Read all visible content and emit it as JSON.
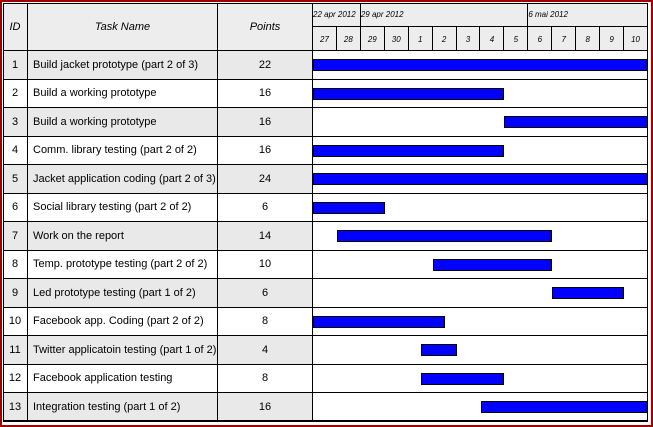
{
  "header": {
    "id": "ID",
    "task": "Task Name",
    "points": "Points"
  },
  "weeks": [
    "22 apr 2012",
    "29 apr 2012",
    "6 mai 2012"
  ],
  "days": [
    "27",
    "28",
    "29",
    "30",
    "1",
    "2",
    "3",
    "4",
    "5",
    "6",
    "7",
    "8",
    "9",
    "10"
  ],
  "tasks": [
    {
      "id": "1",
      "name": "Build jacket prototype (part 2 of 3)",
      "points": "22",
      "start": 0,
      "end": 14
    },
    {
      "id": "2",
      "name": "Build a working prototype",
      "points": "16",
      "start": 0,
      "end": 8
    },
    {
      "id": "3",
      "name": "Build a working prototype",
      "points": "16",
      "start": 8,
      "end": 14
    },
    {
      "id": "4",
      "name": "Comm. library testing (part 2 of 2)",
      "points": "16",
      "start": 0,
      "end": 8
    },
    {
      "id": "5",
      "name": "Jacket application coding (part 2 of 3)",
      "points": "24",
      "start": 0,
      "end": 14
    },
    {
      "id": "6",
      "name": "Social library testing (part 2 of 2)",
      "points": "6",
      "start": 0,
      "end": 3
    },
    {
      "id": "7",
      "name": "Work on the report",
      "points": "14",
      "start": 1,
      "end": 10
    },
    {
      "id": "8",
      "name": "Temp. prototype testing (part 2 of 2)",
      "points": "10",
      "start": 5,
      "end": 10
    },
    {
      "id": "9",
      "name": "Led prototype testing (part 1 of 2)",
      "points": "6",
      "start": 10,
      "end": 13
    },
    {
      "id": "10",
      "name": "Facebook app. Coding (part 2 of 2)",
      "points": "8",
      "start": 0,
      "end": 5.5
    },
    {
      "id": "11",
      "name": "Twitter applicatoin testing (part 1 of 2)",
      "points": "4",
      "start": 4.5,
      "end": 6
    },
    {
      "id": "12",
      "name": "Facebook application testing",
      "points": "8",
      "start": 4.5,
      "end": 8
    },
    {
      "id": "13",
      "name": "Integration testing (part 1 of 2)",
      "points": "16",
      "start": 7,
      "end": 14
    }
  ]
}
